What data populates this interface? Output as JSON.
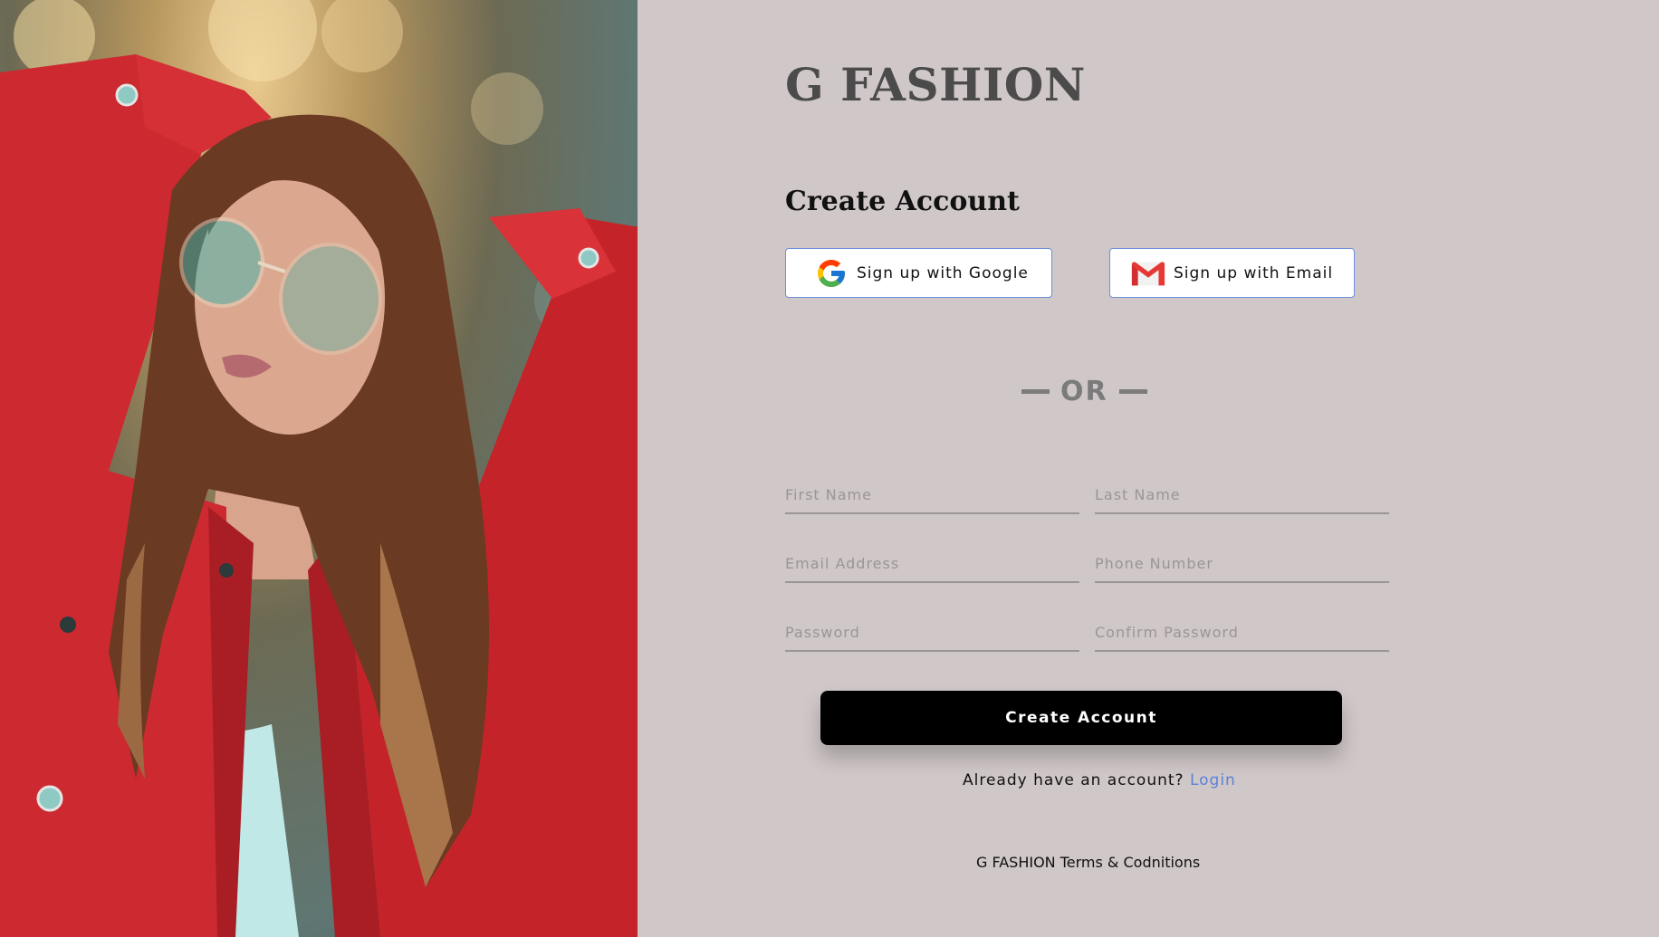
{
  "brand": {
    "name": "G FASHION"
  },
  "form": {
    "heading": "Create Account",
    "social": {
      "google_label": "Sign up with Google",
      "email_label": "Sign up with Email"
    },
    "divider_text": "OR",
    "fields": {
      "first_name_placeholder": "First Name",
      "last_name_placeholder": "Last Name",
      "email_placeholder": "Email Address",
      "phone_placeholder": "Phone Number",
      "password_placeholder": "Password",
      "confirm_password_placeholder": "Confirm Password"
    },
    "submit_label": "Create Account",
    "login_prompt": "Already have an account?",
    "login_link": "Login"
  },
  "footer": {
    "terms": "G FASHION Terms & Codnitions"
  },
  "colors": {
    "background": "#d0c7c8",
    "button": "#000000",
    "link": "#5b82d8",
    "social_border": "#6d8ee0",
    "jacket": "#cc2a30"
  },
  "icons": {
    "google": "google-logo-icon",
    "email": "gmail-logo-icon"
  }
}
